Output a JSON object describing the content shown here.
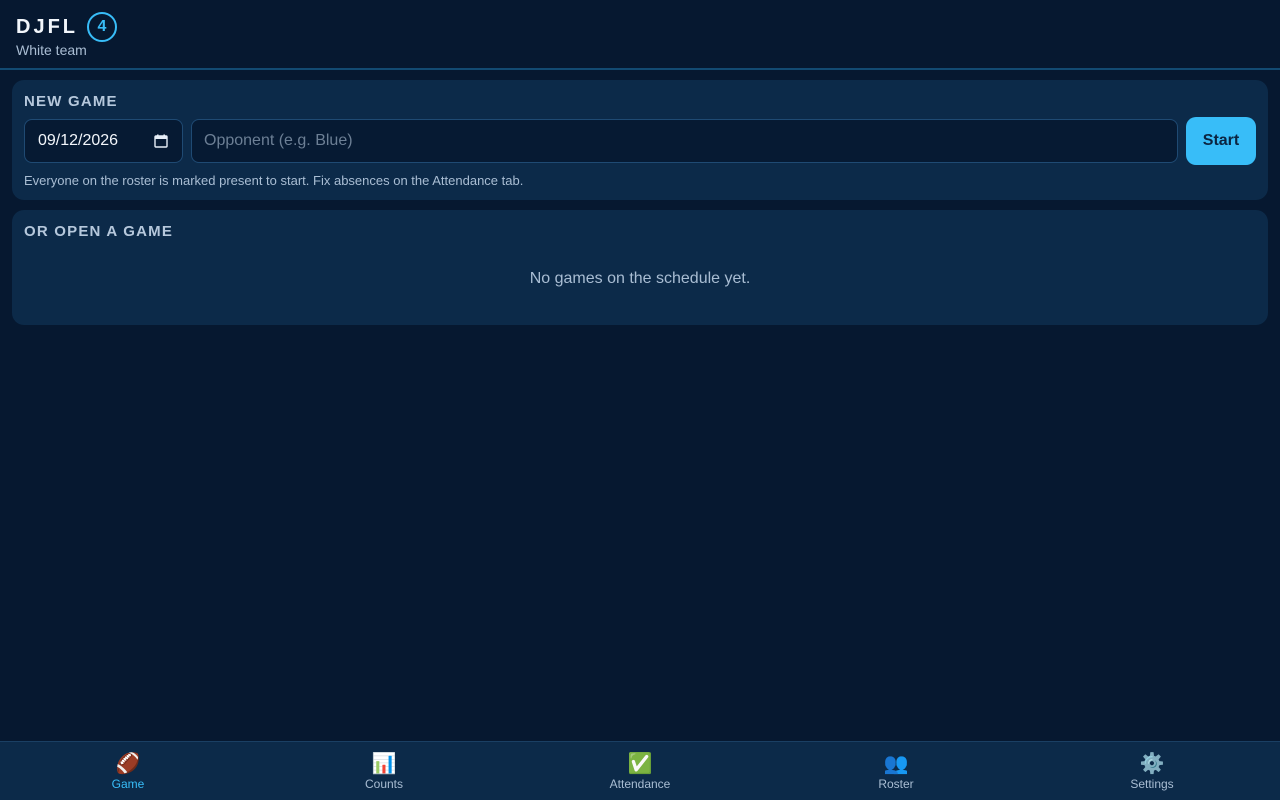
{
  "header": {
    "brand": "DJFL",
    "badge": "4",
    "team": "White team"
  },
  "new_game": {
    "title": "NEW GAME",
    "date_value": "09/12/2026",
    "opponent_placeholder": "Opponent (e.g. Blue)",
    "opponent_value": "",
    "start_label": "Start",
    "hint": "Everyone on the roster is marked present to start. Fix absences on the Attendance tab."
  },
  "open_game": {
    "title": "OR OPEN A GAME",
    "empty_text": "No games on the schedule yet."
  },
  "nav": {
    "items": [
      {
        "label": "Game",
        "icon": "🏈",
        "icon_name": "football-icon",
        "active": true
      },
      {
        "label": "Counts",
        "icon": "📊",
        "icon_name": "bar-chart-icon",
        "active": false
      },
      {
        "label": "Attendance",
        "icon": "✅",
        "icon_name": "check-mark-icon",
        "active": false
      },
      {
        "label": "Roster",
        "icon": "👥",
        "icon_name": "people-icon",
        "active": false
      },
      {
        "label": "Settings",
        "icon": "⚙️",
        "icon_name": "gear-icon",
        "active": false
      }
    ]
  },
  "colors": {
    "background": "#061830",
    "card": "#0c2a49",
    "accent": "#38bdf8",
    "muted_text": "#a9bdd3"
  }
}
